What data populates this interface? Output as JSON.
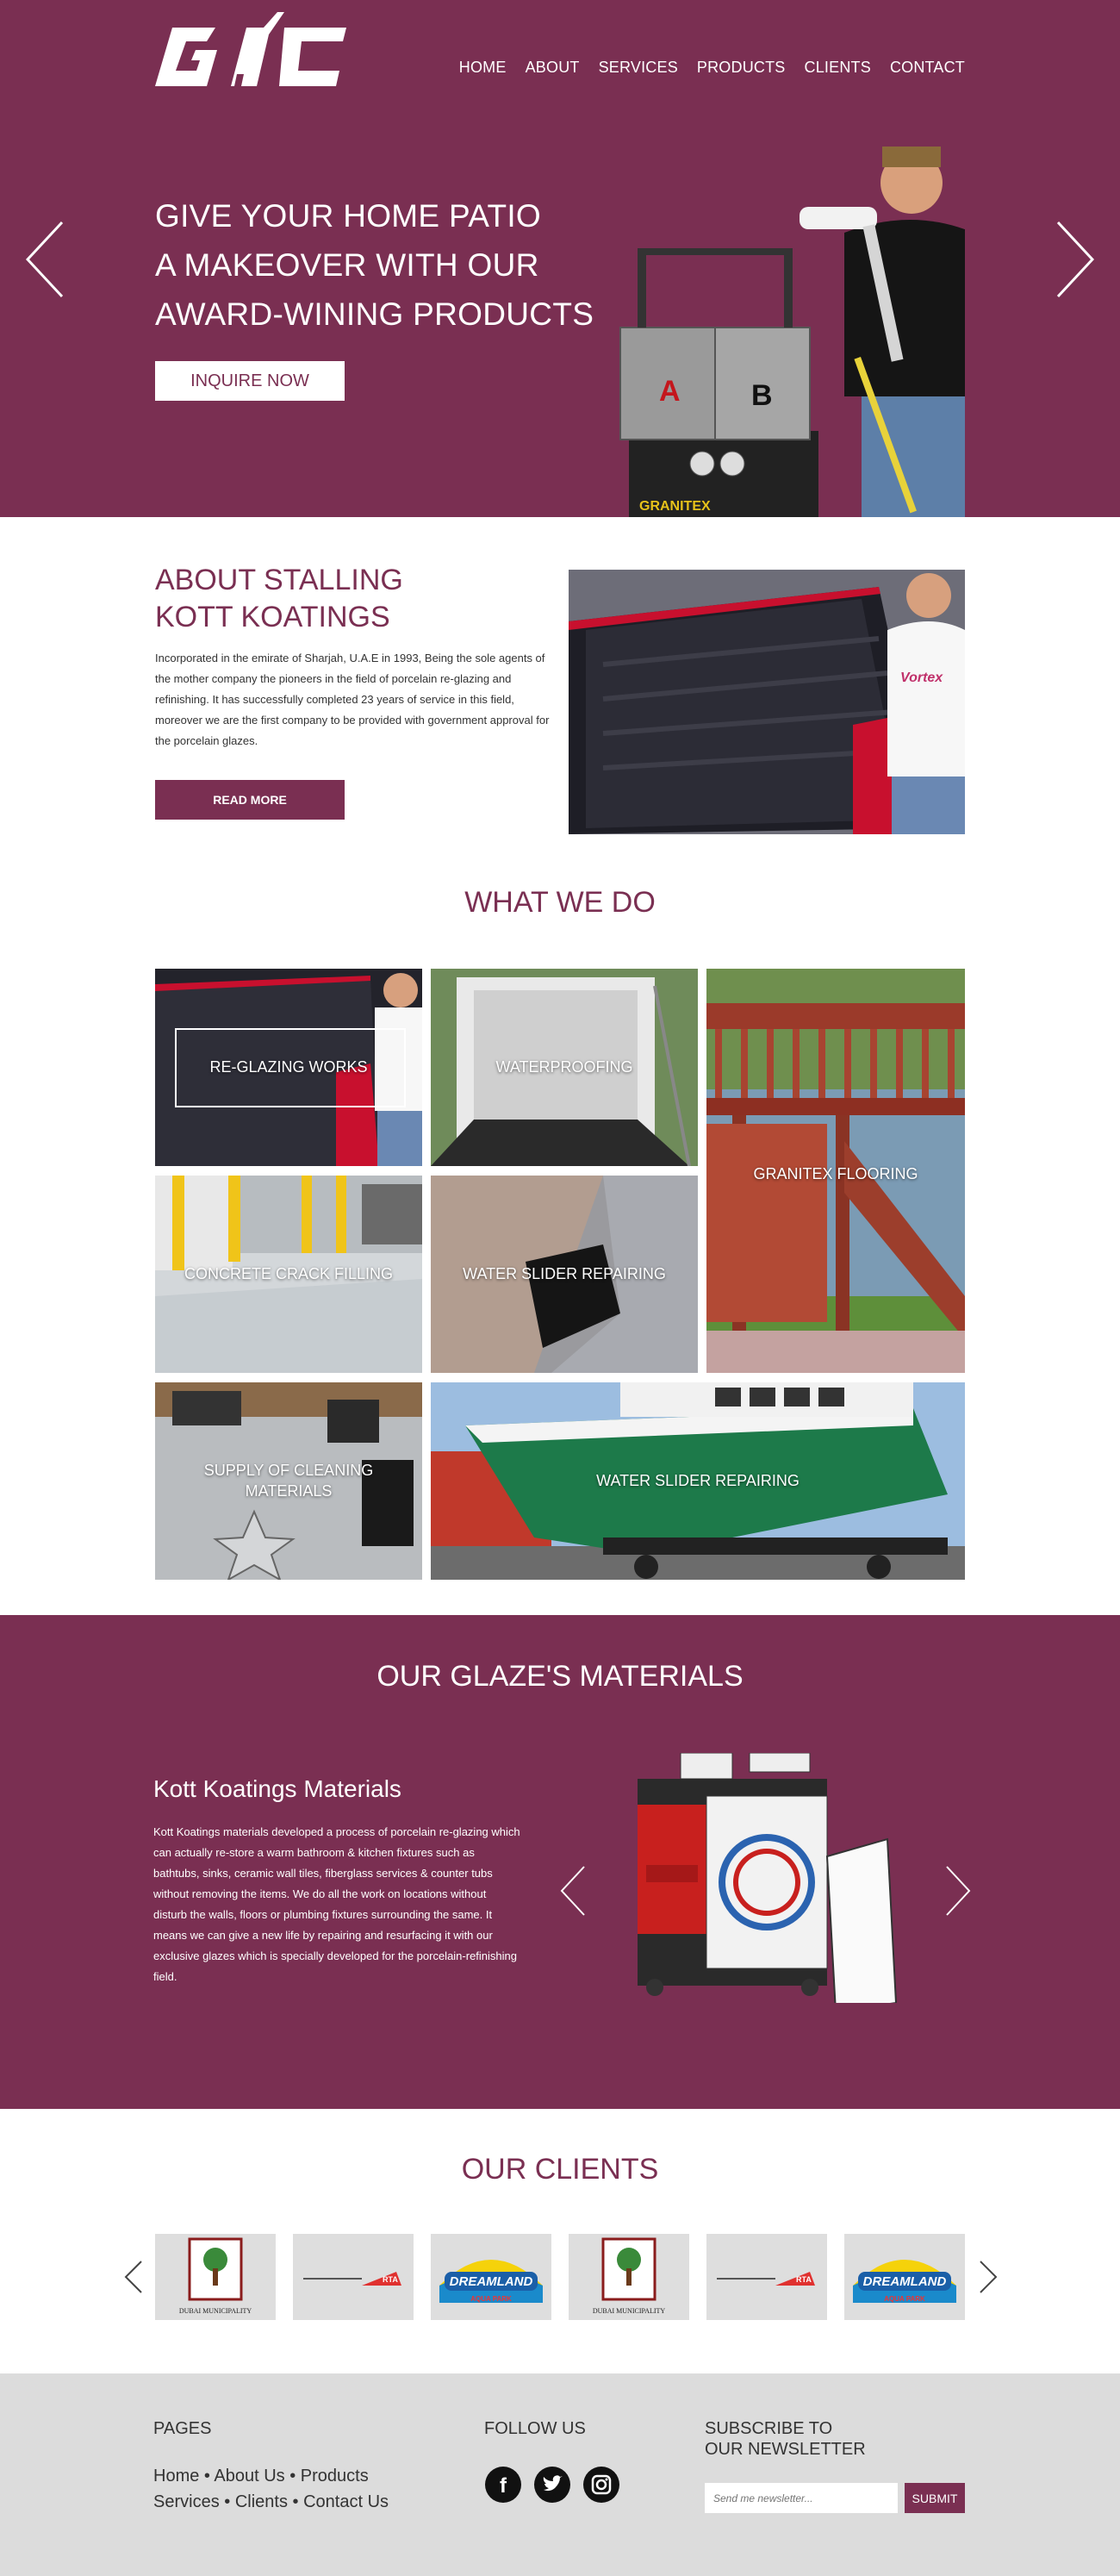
{
  "brand": {
    "logo_text": "GAC",
    "accent": "#7a2f52"
  },
  "nav": [
    "HOME",
    "ABOUT",
    "SERVICES",
    "PRODUCTS",
    "CLIENTS",
    "CONTACT"
  ],
  "hero": {
    "title_lines": [
      "GIVE YOUR HOME PATIO",
      "A MAKEOVER WITH OUR",
      "AWARD-WINING PRODUCTS"
    ],
    "button": "INQUIRE NOW",
    "machine_labels": [
      "A",
      "B",
      "GRANITEX"
    ]
  },
  "about": {
    "title_lines": [
      "ABOUT STALLING",
      "KOTT KOATINGS"
    ],
    "text": "Incorporated in the emirate of Sharjah, U.A.E in 1993, Being the sole agents of the mother company the pioneers in the field of porcelain re-glazing and refinishing. It has successfully completed 23 years of service in this field, moreover we are the first company to be provided with government approval for the porcelain glazes.",
    "button": "READ MORE",
    "image_shirt_text": "Vortex"
  },
  "what_we_do": {
    "heading": "WHAT WE DO",
    "tiles": [
      "RE-GLAZING WORKS",
      "WATERPROOFING",
      "GRANITEX FLOORING",
      "CONCRETE CRACK FILLING",
      "WATER SLIDER REPAIRING",
      "SUPPLY OF CLEANING MATERIALS",
      "WATER SLIDER REPAIRING"
    ]
  },
  "materials": {
    "heading": "OUR GLAZE'S MATERIALS",
    "subtitle": "Kott Koatings Materials",
    "text": "Kott Koatings materials developed a process of porcelain re-glazing which can actually re-store a warm bathroom & kitchen fixtures such as bathtubs, sinks, ceramic wall tiles, fiberglass services & counter tubs without removing the items. We do all the work on locations without disturb the walls, floors or plumbing fixtures surrounding the same. It means we can give a new life by repairing and resurfacing it with our exclusive glazes which is specially developed for the porcelain-refinishing field."
  },
  "clients": {
    "heading": "OUR CLIENTS",
    "logos": [
      {
        "name": "DUBAI MUNICIPALITY",
        "icon": "dubai-municipality-logo"
      },
      {
        "name": "RTA",
        "icon": "rta-logo"
      },
      {
        "name": "DREAMLAND",
        "sub": "AQUA PARK",
        "icon": "dreamland-logo"
      },
      {
        "name": "DUBAI MUNICIPALITY",
        "icon": "dubai-municipality-logo"
      },
      {
        "name": "RTA",
        "icon": "rta-logo"
      },
      {
        "name": "DREAMLAND",
        "sub": "AQUA PARK",
        "icon": "dreamland-logo"
      }
    ]
  },
  "footer": {
    "pages_heading": "PAGES",
    "pages": [
      "Home",
      "About Us",
      "Products",
      "Services",
      "Clients",
      "Contact Us"
    ],
    "follow_heading": "FOLLOW US",
    "social": [
      "facebook",
      "twitter",
      "instagram"
    ],
    "newsletter_heading_lines": [
      "SUBSCRIBE TO",
      "OUR NEWSLETTER"
    ],
    "newsletter_placeholder": "Send me newsletter...",
    "submit": "SUBMIT"
  }
}
